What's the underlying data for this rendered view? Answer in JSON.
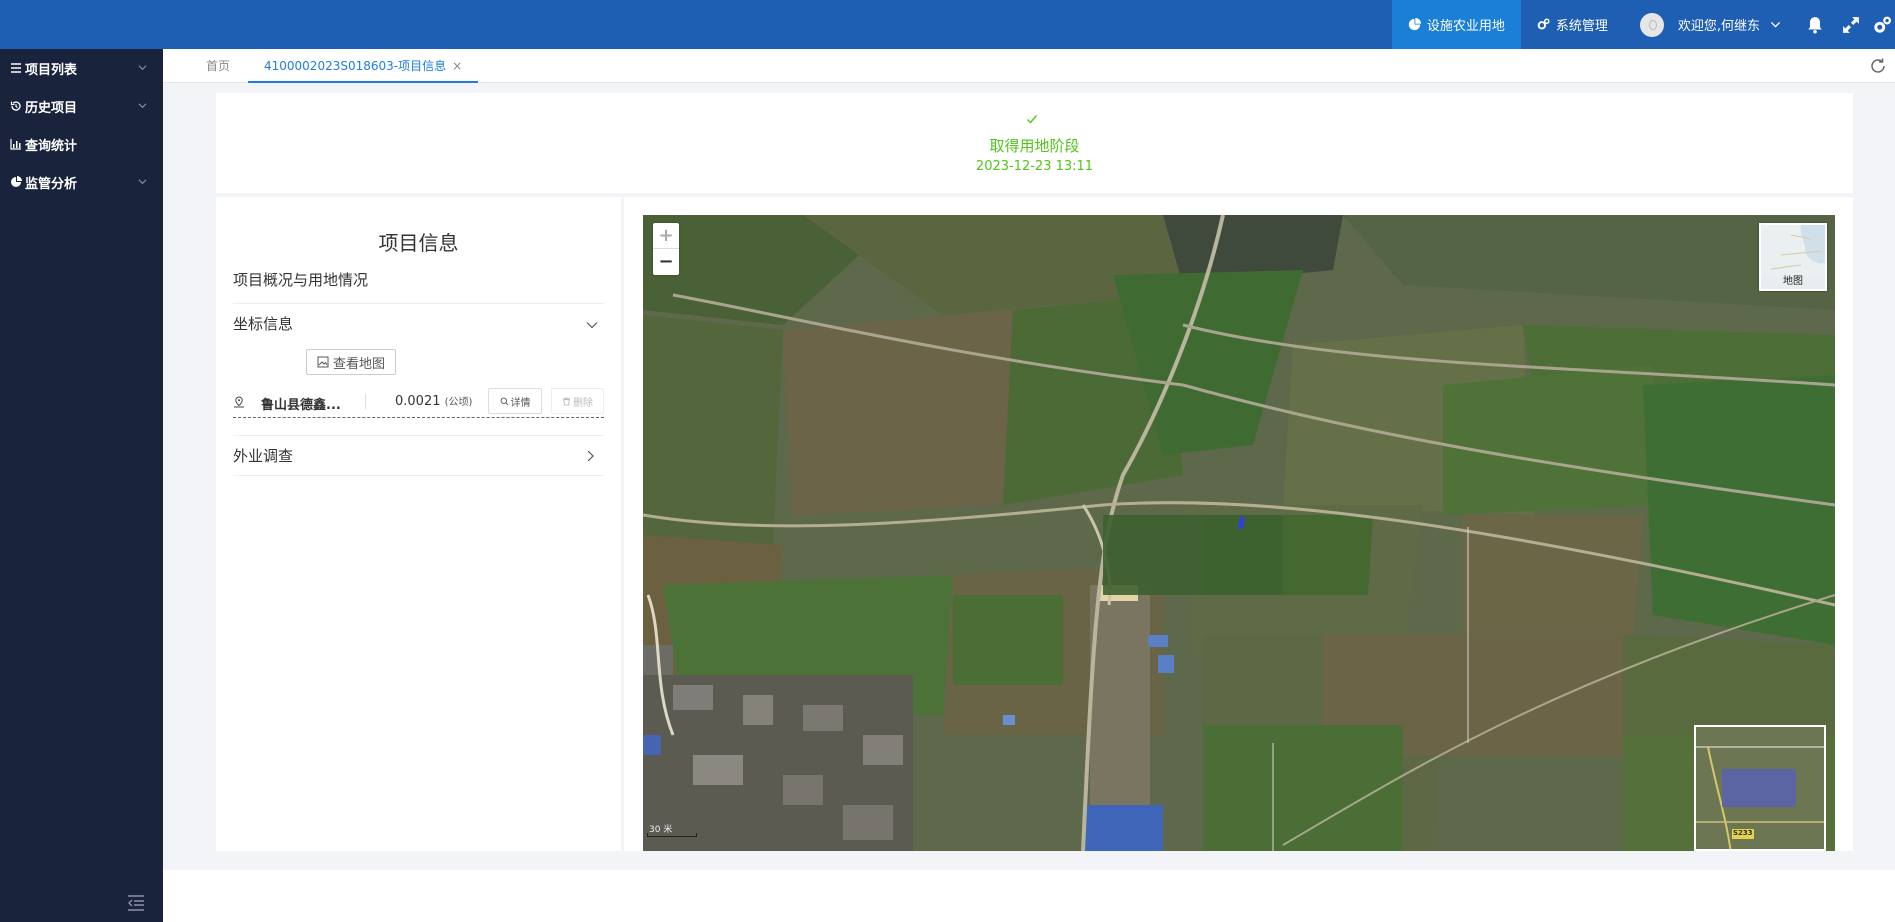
{
  "header": {
    "modules": [
      {
        "label": "设施农业用地",
        "icon": "pie-chart-icon",
        "active": true
      },
      {
        "label": "系统管理",
        "icon": "gears-icon",
        "active": false
      }
    ],
    "user_greeting": "欢迎您,何继东"
  },
  "sidebar": {
    "items": [
      {
        "label": "项目列表",
        "icon": "list-icon"
      },
      {
        "label": "历史项目",
        "icon": "history-icon"
      },
      {
        "label": "查询统计",
        "icon": "bar-chart-icon"
      },
      {
        "label": "监管分析",
        "icon": "pie-chart-icon"
      }
    ]
  },
  "tabs": {
    "home": "首页",
    "active": "4100002023S018603-项目信息",
    "close": "×"
  },
  "stage": {
    "name": "取得用地阶段",
    "time": "2023-12-23 13:11"
  },
  "info": {
    "title": "项目信息",
    "section_overview": "项目概况与用地情况",
    "section_coords": "坐标信息",
    "view_map_button": "查看地图",
    "plot": {
      "name": "鲁山县德鑫...",
      "area": "0.0021",
      "unit": "(公顷)",
      "detail_button": "详情",
      "delete_button": "删除"
    },
    "section_field": "外业调查"
  },
  "map": {
    "zoom_in": "+",
    "zoom_out": "−",
    "layer_label": "地图",
    "scale_label": "30 米",
    "road_label": "S233",
    "accent": "#1e5fb3",
    "success": "#52c41a"
  }
}
